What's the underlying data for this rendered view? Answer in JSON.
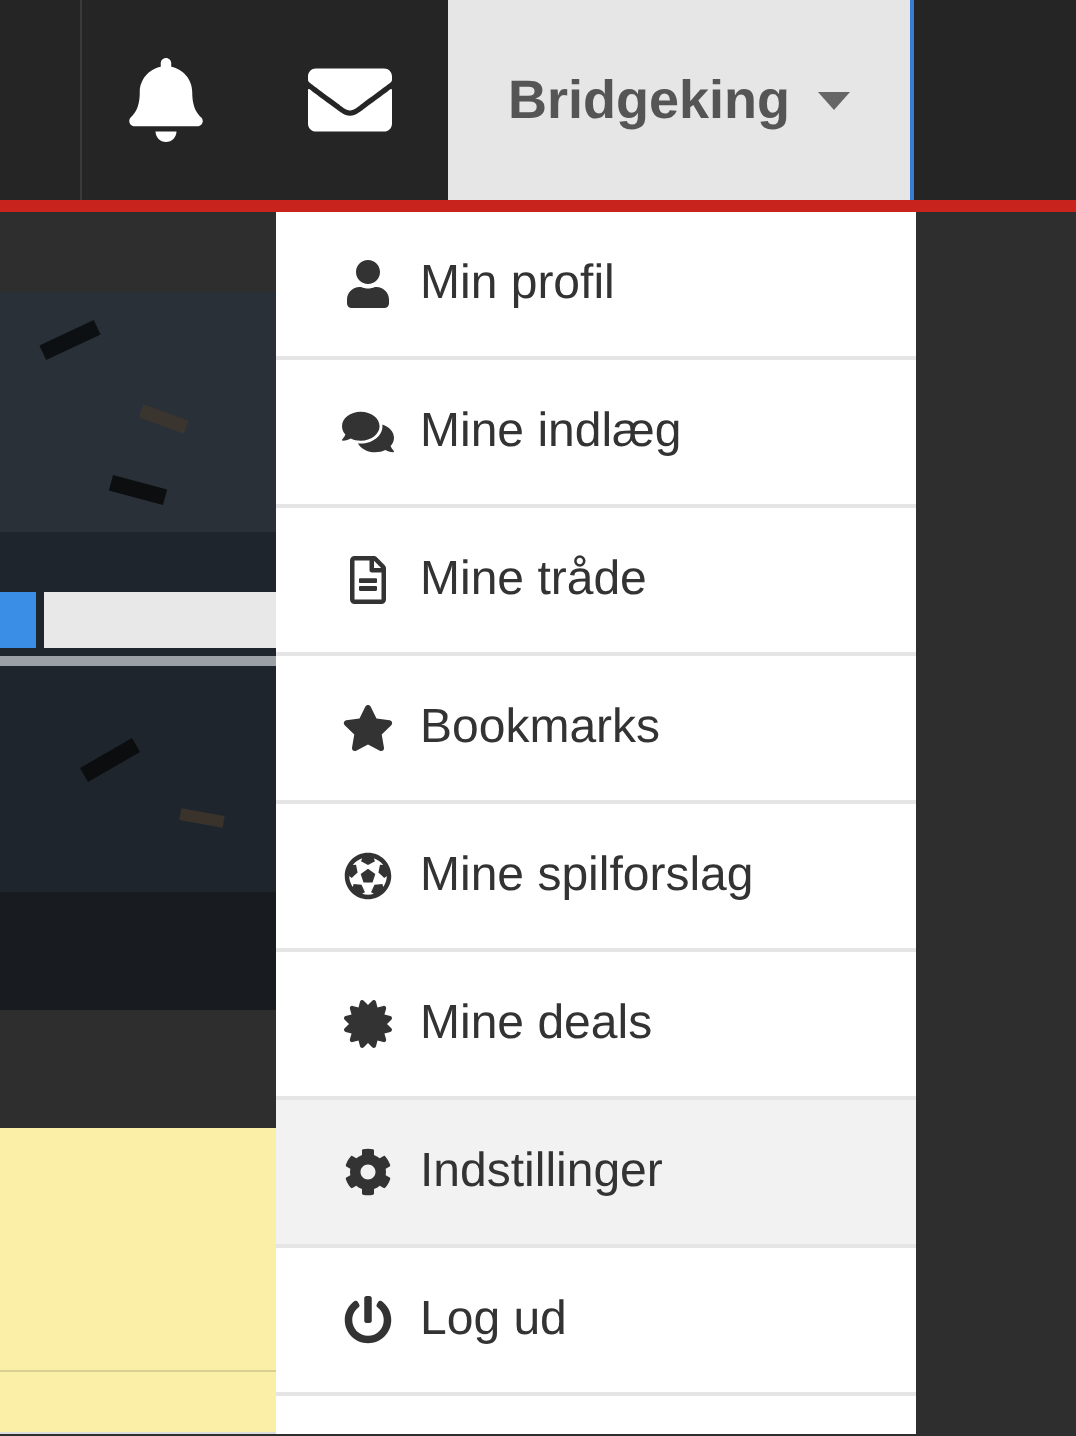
{
  "header": {
    "username": "Bridgeking"
  },
  "menu": {
    "items": [
      {
        "label": "Min profil",
        "selected": false
      },
      {
        "label": "Mine indlæg",
        "selected": false
      },
      {
        "label": "Mine tråde",
        "selected": false
      },
      {
        "label": "Bookmarks",
        "selected": false
      },
      {
        "label": "Mine spilforslag",
        "selected": false
      },
      {
        "label": "Mine deals",
        "selected": false
      },
      {
        "label": "Indstillinger",
        "selected": true
      },
      {
        "label": "Log ud",
        "selected": false
      }
    ]
  }
}
